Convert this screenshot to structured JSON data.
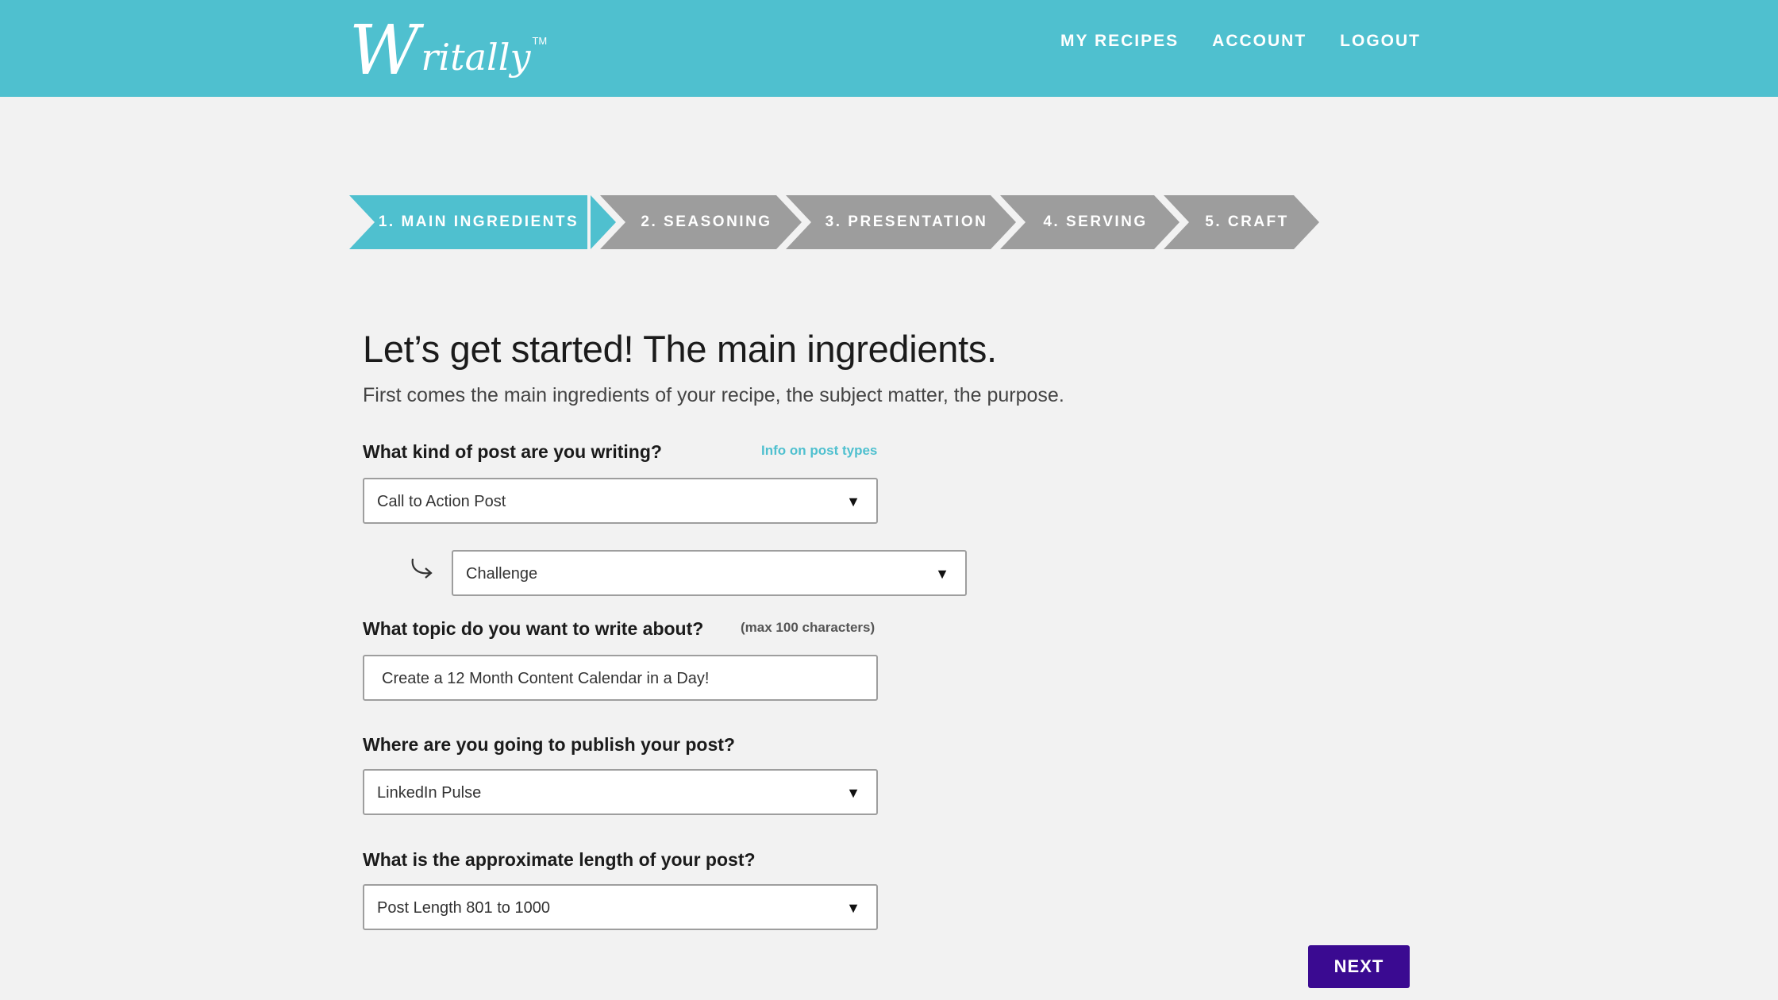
{
  "app": {
    "logo_initial": "W",
    "logo_rest": "ritally",
    "logo_tm": "TM"
  },
  "nav": {
    "items": [
      "MY RECIPES",
      "ACCOUNT",
      "LOGOUT"
    ]
  },
  "steps": [
    {
      "label": "1. MAIN INGREDIENTS",
      "state": "active"
    },
    {
      "label": "2. SEASONING",
      "state": "inactive"
    },
    {
      "label": "3. PRESENTATION",
      "state": "inactive"
    },
    {
      "label": "4. SERVING",
      "state": "inactive"
    },
    {
      "label": "5. CRAFT",
      "state": "inactive"
    }
  ],
  "page": {
    "title": "Let’s get started! The main ingredients.",
    "subtitle": "First comes the main ingredients of your recipe, the subject matter, the purpose."
  },
  "form": {
    "post_type": {
      "label": "What kind of post are you writing?",
      "info_link": "Info on post types",
      "value": "Call to Action Post",
      "sub_value": "Challenge"
    },
    "topic": {
      "label": "What topic do you want to write about?",
      "note": "(max 100 characters)",
      "value": "Create a 12 Month Content Calendar  in a Day!"
    },
    "publish": {
      "label": "Where are you going to publish your post?",
      "value": "LinkedIn Pulse"
    },
    "length": {
      "label": "What is the approximate length of your post?",
      "value": "Post Length 801 to 1000"
    }
  },
  "buttons": {
    "next": "NEXT"
  },
  "colors": {
    "header": "#4fc0cf",
    "step_active": "#4fc0cf",
    "step_inactive": "#9d9d9d",
    "next_button": "#3a0a91",
    "background": "#f2f2f2"
  },
  "icons": {
    "dropdown": "caret-down-icon",
    "sub_option": "curved-arrow-icon"
  }
}
